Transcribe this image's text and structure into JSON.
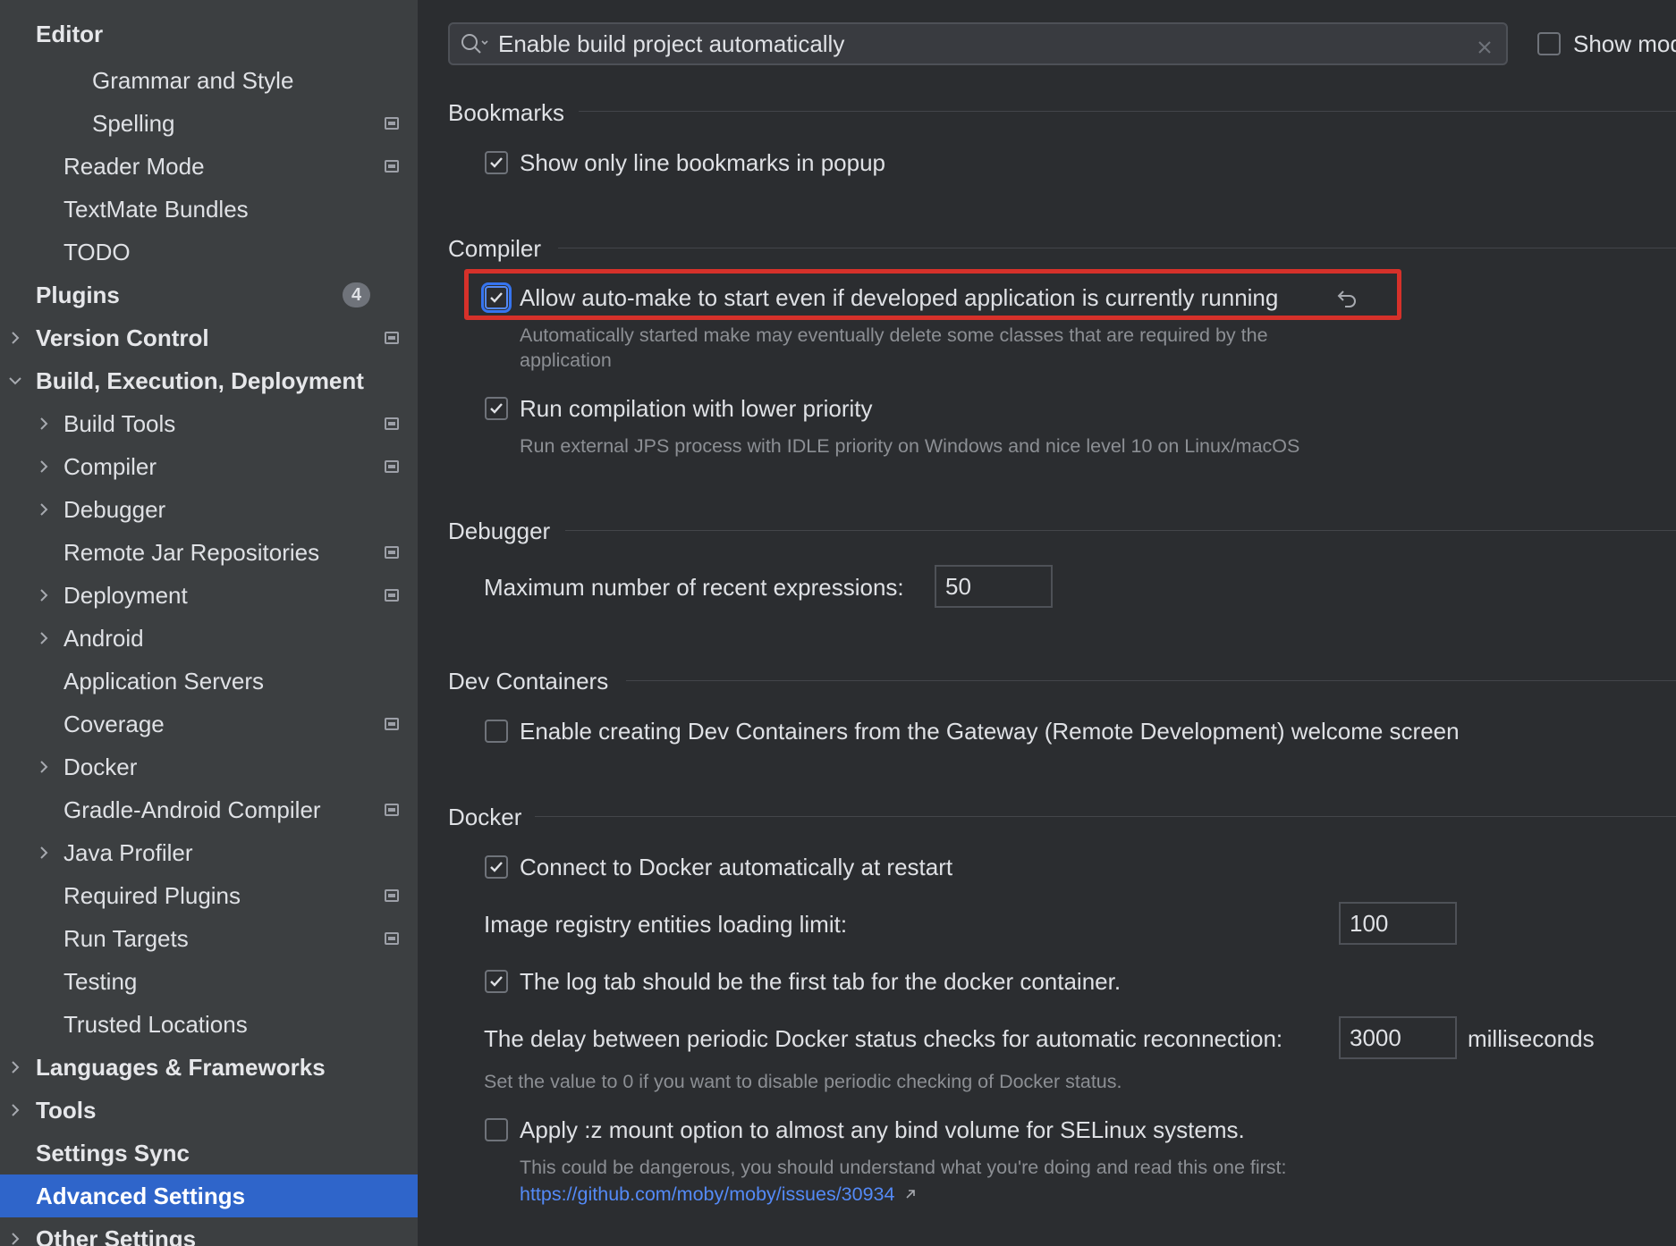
{
  "sidebar": {
    "items": [
      {
        "label": "Editor",
        "bold": true
      },
      {
        "label": "Grammar and Style"
      },
      {
        "label": "Spelling"
      },
      {
        "label": "Reader Mode"
      },
      {
        "label": "TextMate Bundles"
      },
      {
        "label": "TODO"
      },
      {
        "label": "Plugins",
        "bold": true,
        "badge": "4"
      },
      {
        "label": "Version Control",
        "bold": true
      },
      {
        "label": "Build, Execution, Deployment",
        "bold": true
      },
      {
        "label": "Build Tools"
      },
      {
        "label": "Compiler"
      },
      {
        "label": "Debugger"
      },
      {
        "label": "Remote Jar Repositories"
      },
      {
        "label": "Deployment"
      },
      {
        "label": "Android"
      },
      {
        "label": "Application Servers"
      },
      {
        "label": "Coverage"
      },
      {
        "label": "Docker"
      },
      {
        "label": "Gradle-Android Compiler"
      },
      {
        "label": "Java Profiler"
      },
      {
        "label": "Required Plugins"
      },
      {
        "label": "Run Targets"
      },
      {
        "label": "Testing"
      },
      {
        "label": "Trusted Locations"
      },
      {
        "label": "Languages & Frameworks",
        "bold": true
      },
      {
        "label": "Tools",
        "bold": true
      },
      {
        "label": "Settings Sync",
        "bold": true
      },
      {
        "label": "Advanced Settings",
        "bold": true,
        "selected": true
      },
      {
        "label": "Other Settings",
        "bold": true
      }
    ]
  },
  "search": {
    "value": "Enable build project automatically",
    "show_modified_label": "Show mod"
  },
  "bookmarks": {
    "title": "Bookmarks",
    "show_only_line_label": "Show only line bookmarks in popup"
  },
  "compiler": {
    "title": "Compiler",
    "auto_make_label": "Allow auto-make to start even if developed application is currently running",
    "auto_make_hint_1": "Automatically started make may eventually delete some classes that are required by the",
    "auto_make_hint_2": "application",
    "lower_priority_label": "Run compilation with lower priority",
    "lower_priority_hint": "Run external JPS process with IDLE priority on Windows and nice level 10 on Linux/macOS"
  },
  "debugger": {
    "title": "Debugger",
    "max_expressions_label": "Maximum number of recent expressions:",
    "max_expressions_value": "50"
  },
  "dev_containers": {
    "title": "Dev Containers",
    "enable_label": "Enable creating Dev Containers from the Gateway (Remote Development) welcome screen"
  },
  "docker": {
    "title": "Docker",
    "connect_label": "Connect to Docker automatically at restart",
    "registry_limit_label": "Image registry entities loading limit:",
    "registry_limit_value": "100",
    "log_tab_label": "The log tab should be the first tab for the docker container.",
    "delay_label": "The delay between periodic Docker status checks for automatic reconnection:",
    "delay_value": "3000",
    "delay_unit": "milliseconds",
    "delay_hint": "Set the value to 0 if you want to disable periodic checking of Docker status.",
    "mount_label": "Apply :z mount option to almost any bind volume for SELinux systems.",
    "mount_hint": "This could be dangerous, you should understand what you're doing and read this one first:",
    "mount_link": "https://github.com/moby/moby/issues/30934"
  },
  "colors": {
    "selection": "#2f65ca",
    "highlight": "#d6312a",
    "link": "#548af7"
  }
}
